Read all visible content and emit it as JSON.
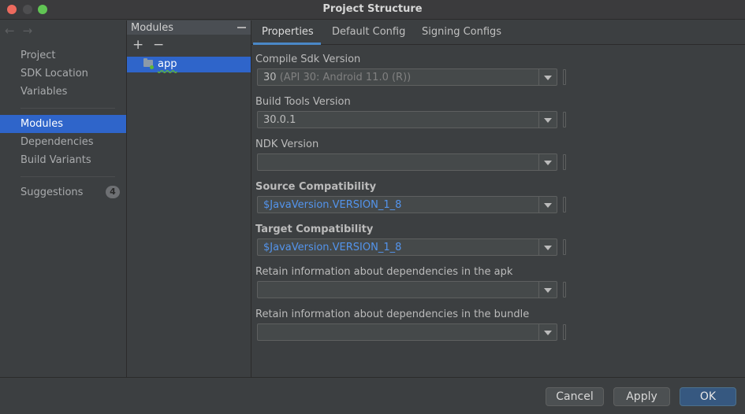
{
  "window": {
    "title": "Project Structure"
  },
  "nav": {
    "back": "←",
    "forward": "→"
  },
  "sidebar": {
    "items": [
      {
        "label": "Project"
      },
      {
        "label": "SDK Location"
      },
      {
        "label": "Variables"
      },
      {
        "label": "Modules",
        "selected": true
      },
      {
        "label": "Dependencies"
      },
      {
        "label": "Build Variants"
      },
      {
        "label": "Suggestions",
        "badge": "4"
      }
    ]
  },
  "modules": {
    "title": "Modules",
    "add": "+",
    "remove": "−",
    "items": [
      {
        "label": "app",
        "icon": "module-folder-icon"
      }
    ]
  },
  "tabs": [
    {
      "label": "Properties",
      "active": true
    },
    {
      "label": "Default Config"
    },
    {
      "label": "Signing Configs"
    }
  ],
  "fields": [
    {
      "label": "Compile Sdk Version",
      "value": "30",
      "hint": "(API 30: Android 11.0 (R))"
    },
    {
      "label": "Build Tools Version",
      "value": "30.0.1"
    },
    {
      "label": "NDK Version",
      "value": ""
    },
    {
      "label": "Source Compatibility",
      "value": "$JavaVersion.VERSION_1_8"
    },
    {
      "label": "Target Compatibility",
      "value": "$JavaVersion.VERSION_1_8"
    },
    {
      "label": "Retain information about dependencies in the apk",
      "value": ""
    },
    {
      "label": "Retain information about dependencies in the bundle",
      "value": ""
    }
  ],
  "footer": {
    "cancel": "Cancel",
    "apply": "Apply",
    "ok": "OK"
  },
  "colors": {
    "selection": "#2f65ca",
    "link_value": "#5394ec",
    "primary_button": "#365880"
  }
}
